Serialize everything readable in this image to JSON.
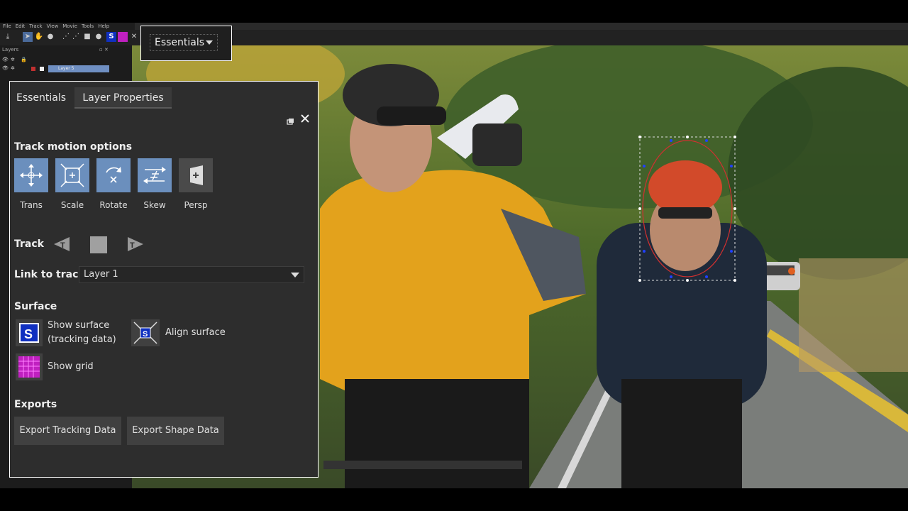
{
  "menubar": {
    "items": [
      "File",
      "Edit",
      "Track",
      "View",
      "Movie",
      "Tools",
      "Help"
    ]
  },
  "layers_panel": {
    "title": "Layers",
    "selected_layer": "Layer 5"
  },
  "workspace_select": {
    "value": "Essentials"
  },
  "panel": {
    "tabs": [
      {
        "label": "Essentials"
      },
      {
        "label": "Layer Properties"
      }
    ],
    "track_motion": {
      "heading": "Track motion options",
      "options": [
        {
          "label": "Trans",
          "active": true
        },
        {
          "label": "Scale",
          "active": true
        },
        {
          "label": "Rotate",
          "active": true
        },
        {
          "label": "Skew",
          "active": true
        },
        {
          "label": "Persp",
          "active": false
        }
      ]
    },
    "track": {
      "label": "Track"
    },
    "link": {
      "label": "Link to track",
      "value": "Layer 1"
    },
    "surface": {
      "heading": "Surface",
      "show_surface": "Show surface",
      "show_surface_sub": "(tracking data)",
      "align_surface": "Align surface",
      "show_grid": "Show grid"
    },
    "exports": {
      "heading": "Exports",
      "export_tracking": "Export Tracking Data",
      "export_shape": "Export Shape Data"
    }
  },
  "colors": {
    "accent": "#6b8fbd",
    "grid": "#c020c0",
    "surface_blue": "#1030c0"
  }
}
